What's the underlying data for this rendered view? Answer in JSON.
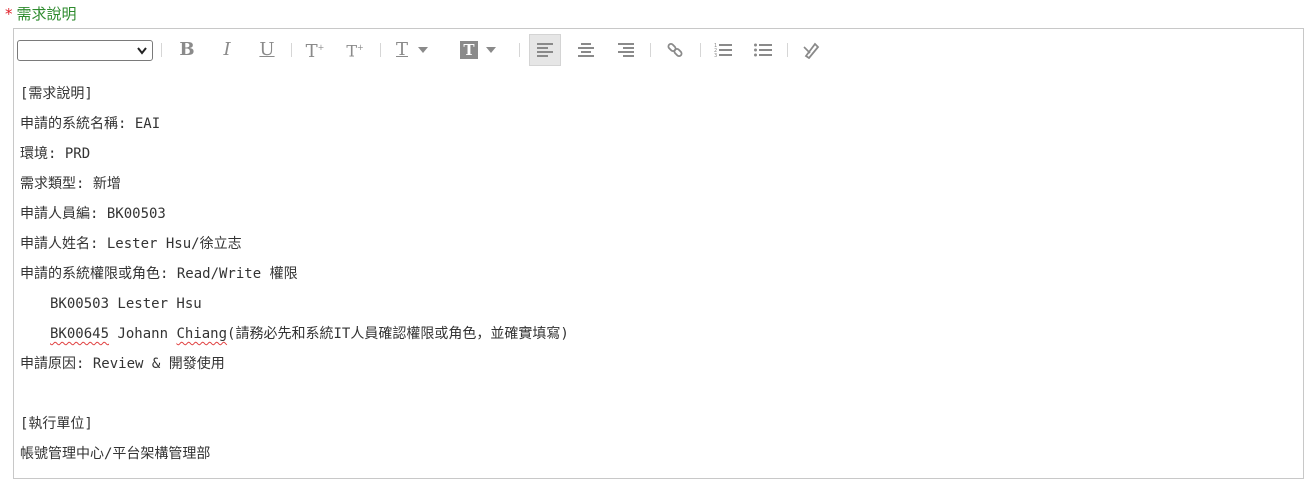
{
  "field": {
    "required_mark": "*",
    "label": "需求說明"
  },
  "toolbar": {
    "font_select_value": "",
    "icons": [
      "bold-icon",
      "italic-icon",
      "underline-icon",
      "superscript-icon",
      "subscript-icon",
      "text-color-icon",
      "background-color-icon",
      "align-left-icon",
      "align-center-icon",
      "align-right-icon",
      "link-icon",
      "ordered-list-icon",
      "unordered-list-icon",
      "remove-format-icon"
    ],
    "active": "align-left",
    "glyphs": {
      "bold": "B",
      "italic": "I",
      "underline": "U",
      "superscript": "T",
      "subscript": "T",
      "text_color": "T",
      "background_color": "T"
    }
  },
  "content": {
    "lines": [
      "[需求說明]",
      "申請的系統名稱: EAI",
      "環境: PRD",
      "需求類型: 新增",
      "申請人員編: BK00503",
      "申請人姓名: Lester Hsu/徐立志",
      "申請的系統權限或角色: Read/Write 權限",
      "BK00503 Lester Hsu",
      "(請務必先和系統IT人員確認權限或角色，並確實填寫)",
      "申請原因: Review & 開發使用",
      "",
      "[執行單位]",
      "帳號管理中心/平台架構管理部"
    ],
    "line9_parts": {
      "id": "BK00645",
      "first": "Johann",
      "last": "Chiang"
    }
  },
  "colors": {
    "required": "#e0202a",
    "label": "#2e8b2e",
    "icon": "#8a8a8a",
    "border": "#c8c8c8"
  }
}
